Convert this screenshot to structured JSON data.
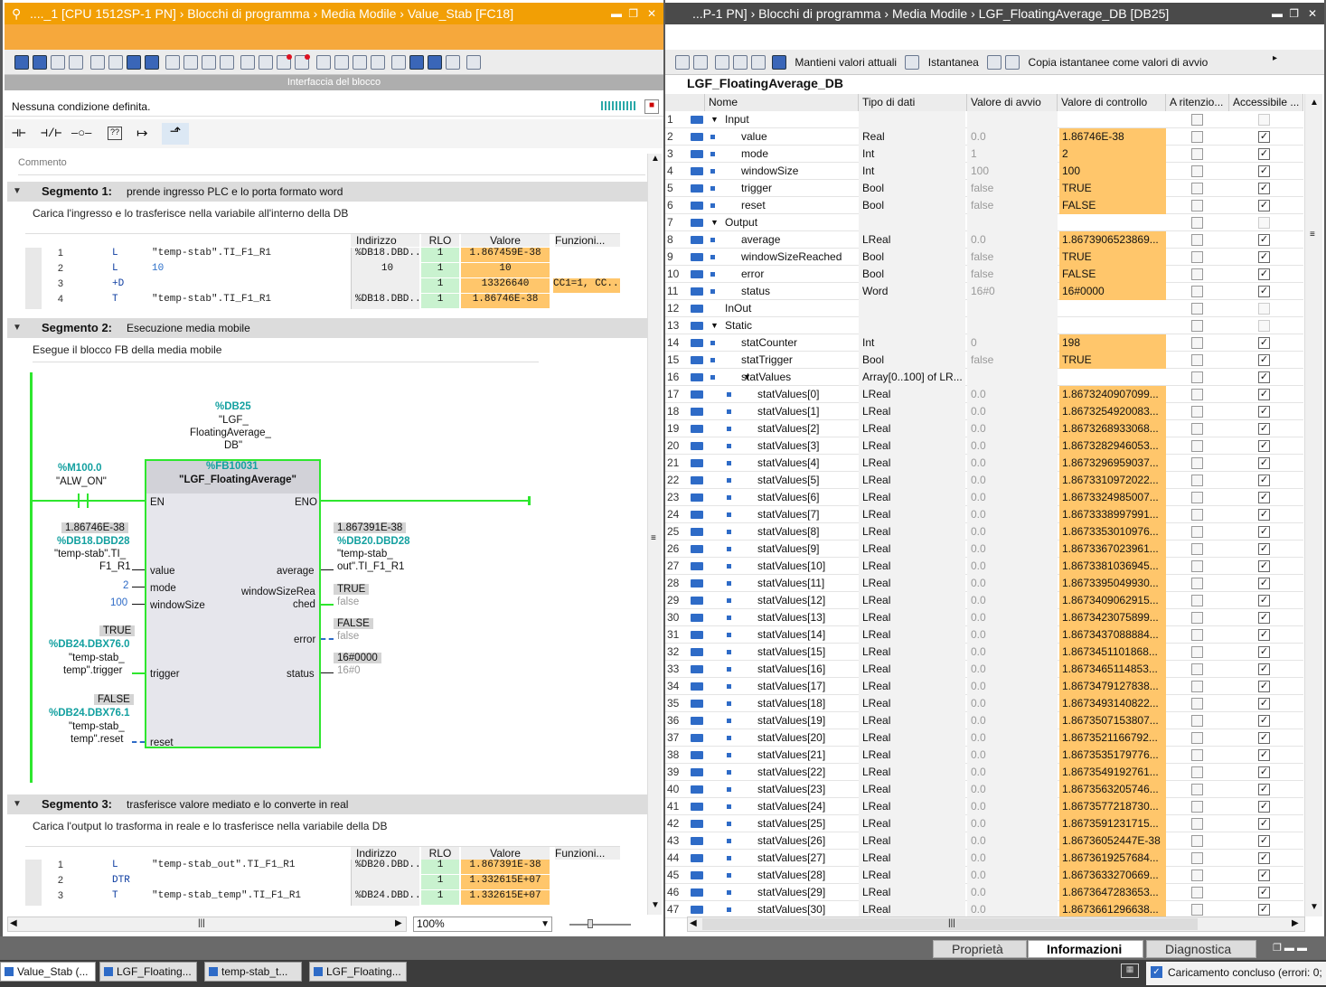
{
  "left": {
    "title": "...._1 [CPU 1512SP-1 PN]  ›  Blocchi di programma  ›  Media Modile  ›  Value_Stab [FC18]",
    "interface_label": "Interfaccia del blocco",
    "no_condition": "Nessuna condizione definita.",
    "comment_placeholder": "Commento",
    "zoom": "100%",
    "seg1": {
      "title": "Segmento 1:",
      "desc": "prende ingresso PLC e lo porta formato word",
      "comment": "Carica l'ingresso e lo trasferisce nella variabile all'interno della DB",
      "headers": {
        "addr": "Indirizzo",
        "rlo": "RLO",
        "val": "Valore",
        "fn": "Funzioni..."
      },
      "rows": [
        {
          "n": "1",
          "op": "L",
          "arg": "\"temp-stab\".TI_F1_R1",
          "addr": "%DB18.DBD...",
          "rlo": "1",
          "val": "1.867459E-38",
          "fn": ""
        },
        {
          "n": "2",
          "op": "L",
          "arg": "10",
          "addr": "10",
          "rlo": "1",
          "val": "10",
          "fn": ""
        },
        {
          "n": "3",
          "op": "+D",
          "arg": "",
          "addr": "",
          "rlo": "1",
          "val": "13326640",
          "fn": "CC1=1, CC..."
        },
        {
          "n": "4",
          "op": "T",
          "arg": "\"temp-stab\".TI_F1_R1",
          "addr": "%DB18.DBD...",
          "rlo": "1",
          "val": "1.86746E-38",
          "fn": ""
        }
      ]
    },
    "seg2": {
      "title": "Segmento 2:",
      "desc": "Esecuzione media mobile",
      "comment": "Esegue il blocco FB della media mobile",
      "db": "%DB25",
      "db_name1": "\"LGF_",
      "db_name2": "FloatingAverage_",
      "db_name3": "DB\"",
      "fb": "%FB10031",
      "fb_name": "\"LGF_FloatingAverage\"",
      "m_addr": "%M100.0",
      "m_name": "\"ALW_ON\"",
      "en": "EN",
      "eno": "ENO",
      "in_value_live": "1.86746E-38",
      "in_value_addr": "%DB18.DBD28",
      "in_value_name1": "\"temp-stab\".TI_",
      "in_value_name2": "F1_R1",
      "pin_value": "value",
      "pin_mode": "mode",
      "pin_window": "windowSize",
      "pin_trigger": "trigger",
      "pin_reset": "reset",
      "mode_val": "2",
      "window_val": "100",
      "trig_live": "TRUE",
      "trig_addr": "%DB24.DBX76.0",
      "trig_name1": "\"temp-stab_",
      "trig_name2": "temp\".trigger",
      "reset_live": "FALSE",
      "reset_addr": "%DB24.DBX76.1",
      "reset_name1": "\"temp-stab_",
      "reset_name2": "temp\".reset",
      "pin_average": "average",
      "pin_wsr1": "windowSizeRea",
      "pin_wsr2": "ched",
      "pin_error": "error",
      "pin_status": "status",
      "avg_live": "1.867391E-38",
      "avg_addr": "%DB20.DBD28",
      "avg_name1": "\"temp-stab_",
      "avg_name2": "out\".TI_F1_R1",
      "wsr_live": "TRUE",
      "wsr_def": "false",
      "err_live": "FALSE",
      "err_def": "false",
      "st_live": "16#0000",
      "st_def": "16#0"
    },
    "seg3": {
      "title": "Segmento 3:",
      "desc": "trasferisce valore mediato e lo converte in real",
      "comment": "Carica l'output lo trasforma in reale e lo trasferisce nella variabile della DB",
      "rows": [
        {
          "n": "1",
          "op": "L",
          "arg": "\"temp-stab_out\".TI_F1_R1",
          "addr": "%DB20.DBD...",
          "rlo": "1",
          "val": "1.867391E-38",
          "fn": ""
        },
        {
          "n": "2",
          "op": "DTR",
          "arg": "",
          "addr": "",
          "rlo": "1",
          "val": "1.332615E+07",
          "fn": ""
        },
        {
          "n": "3",
          "op": "T",
          "arg": "\"temp-stab_temp\".TI_F1_R1",
          "addr": "%DB24.DBD...",
          "rlo": "1",
          "val": "1.332615E+07",
          "fn": ""
        }
      ]
    }
  },
  "right": {
    "title": "...P-1 PN]  ›  Blocchi di programma  ›  Media Modile  ›  LGF_FloatingAverage_DB [DB25]",
    "toolbar": {
      "keep": "Mantieni valori attuali",
      "snapshot": "Istantanea",
      "copy": "Copia istantanee come valori di avvio"
    },
    "db_title": "LGF_FloatingAverage_DB",
    "headers": {
      "name": "Nome",
      "type": "Tipo di dati",
      "start": "Valore di avvio",
      "monitor": "Valore di controllo",
      "retain": "A ritenzio...",
      "access": "Accessibile ..."
    },
    "rows": [
      {
        "n": "1",
        "name": "Input",
        "lvl": 0,
        "tw": "▼",
        "type": "",
        "start": "",
        "mon": "",
        "dot": false,
        "acc": false
      },
      {
        "n": "2",
        "name": "value",
        "lvl": 1,
        "type": "Real",
        "start": "0.0",
        "mon": "1.86746E-38",
        "dot": true,
        "acc": true
      },
      {
        "n": "3",
        "name": "mode",
        "lvl": 1,
        "type": "Int",
        "start": "1",
        "mon": "2",
        "dot": true,
        "acc": true
      },
      {
        "n": "4",
        "name": "windowSize",
        "lvl": 1,
        "type": "Int",
        "start": "100",
        "mon": "100",
        "dot": true,
        "acc": true
      },
      {
        "n": "5",
        "name": "trigger",
        "lvl": 1,
        "type": "Bool",
        "start": "false",
        "mon": "TRUE",
        "dot": true,
        "acc": true
      },
      {
        "n": "6",
        "name": "reset",
        "lvl": 1,
        "type": "Bool",
        "start": "false",
        "mon": "FALSE",
        "dot": true,
        "acc": true
      },
      {
        "n": "7",
        "name": "Output",
        "lvl": 0,
        "tw": "▼",
        "type": "",
        "start": "",
        "mon": "",
        "dot": false,
        "acc": false
      },
      {
        "n": "8",
        "name": "average",
        "lvl": 1,
        "type": "LReal",
        "start": "0.0",
        "mon": "1.8673906523869...",
        "dot": true,
        "acc": true
      },
      {
        "n": "9",
        "name": "windowSizeReached",
        "lvl": 1,
        "type": "Bool",
        "start": "false",
        "mon": "TRUE",
        "dot": true,
        "acc": true
      },
      {
        "n": "10",
        "name": "error",
        "lvl": 1,
        "type": "Bool",
        "start": "false",
        "mon": "FALSE",
        "dot": true,
        "acc": true
      },
      {
        "n": "11",
        "name": "status",
        "lvl": 1,
        "type": "Word",
        "start": "16#0",
        "mon": "16#0000",
        "dot": true,
        "acc": true
      },
      {
        "n": "12",
        "name": "InOut",
        "lvl": 0,
        "tw": "",
        "type": "",
        "start": "",
        "mon": "",
        "dot": false,
        "acc": false
      },
      {
        "n": "13",
        "name": "Static",
        "lvl": 0,
        "tw": "▼",
        "type": "",
        "start": "",
        "mon": "",
        "dot": false,
        "acc": false
      },
      {
        "n": "14",
        "name": "statCounter",
        "lvl": 1,
        "type": "Int",
        "start": "0",
        "mon": "198",
        "dot": true,
        "acc": true
      },
      {
        "n": "15",
        "name": "statTrigger",
        "lvl": 1,
        "type": "Bool",
        "start": "false",
        "mon": "TRUE",
        "dot": true,
        "acc": true
      },
      {
        "n": "16",
        "name": "statValues",
        "lvl": 1,
        "tw": "▼",
        "type": "Array[0..100] of LR...",
        "start": "",
        "mon": "",
        "dot": true,
        "acc": true
      },
      {
        "n": "17",
        "name": "statValues[0]",
        "lvl": 2,
        "type": "LReal",
        "start": "0.0",
        "mon": "1.8673240907099...",
        "dot": true,
        "acc": true
      },
      {
        "n": "18",
        "name": "statValues[1]",
        "lvl": 2,
        "type": "LReal",
        "start": "0.0",
        "mon": "1.8673254920083...",
        "dot": true,
        "acc": true
      },
      {
        "n": "19",
        "name": "statValues[2]",
        "lvl": 2,
        "type": "LReal",
        "start": "0.0",
        "mon": "1.8673268933068...",
        "dot": true,
        "acc": true
      },
      {
        "n": "20",
        "name": "statValues[3]",
        "lvl": 2,
        "type": "LReal",
        "start": "0.0",
        "mon": "1.8673282946053...",
        "dot": true,
        "acc": true
      },
      {
        "n": "21",
        "name": "statValues[4]",
        "lvl": 2,
        "type": "LReal",
        "start": "0.0",
        "mon": "1.8673296959037...",
        "dot": true,
        "acc": true
      },
      {
        "n": "22",
        "name": "statValues[5]",
        "lvl": 2,
        "type": "LReal",
        "start": "0.0",
        "mon": "1.8673310972022...",
        "dot": true,
        "acc": true
      },
      {
        "n": "23",
        "name": "statValues[6]",
        "lvl": 2,
        "type": "LReal",
        "start": "0.0",
        "mon": "1.8673324985007...",
        "dot": true,
        "acc": true
      },
      {
        "n": "24",
        "name": "statValues[7]",
        "lvl": 2,
        "type": "LReal",
        "start": "0.0",
        "mon": "1.8673338997991...",
        "dot": true,
        "acc": true
      },
      {
        "n": "25",
        "name": "statValues[8]",
        "lvl": 2,
        "type": "LReal",
        "start": "0.0",
        "mon": "1.8673353010976...",
        "dot": true,
        "acc": true
      },
      {
        "n": "26",
        "name": "statValues[9]",
        "lvl": 2,
        "type": "LReal",
        "start": "0.0",
        "mon": "1.8673367023961...",
        "dot": true,
        "acc": true
      },
      {
        "n": "27",
        "name": "statValues[10]",
        "lvl": 2,
        "type": "LReal",
        "start": "0.0",
        "mon": "1.8673381036945...",
        "dot": true,
        "acc": true
      },
      {
        "n": "28",
        "name": "statValues[11]",
        "lvl": 2,
        "type": "LReal",
        "start": "0.0",
        "mon": "1.8673395049930...",
        "dot": true,
        "acc": true
      },
      {
        "n": "29",
        "name": "statValues[12]",
        "lvl": 2,
        "type": "LReal",
        "start": "0.0",
        "mon": "1.8673409062915...",
        "dot": true,
        "acc": true
      },
      {
        "n": "30",
        "name": "statValues[13]",
        "lvl": 2,
        "type": "LReal",
        "start": "0.0",
        "mon": "1.8673423075899...",
        "dot": true,
        "acc": true
      },
      {
        "n": "31",
        "name": "statValues[14]",
        "lvl": 2,
        "type": "LReal",
        "start": "0.0",
        "mon": "1.8673437088884...",
        "dot": true,
        "acc": true
      },
      {
        "n": "32",
        "name": "statValues[15]",
        "lvl": 2,
        "type": "LReal",
        "start": "0.0",
        "mon": "1.8673451101868...",
        "dot": true,
        "acc": true
      },
      {
        "n": "33",
        "name": "statValues[16]",
        "lvl": 2,
        "type": "LReal",
        "start": "0.0",
        "mon": "1.8673465114853...",
        "dot": true,
        "acc": true
      },
      {
        "n": "34",
        "name": "statValues[17]",
        "lvl": 2,
        "type": "LReal",
        "start": "0.0",
        "mon": "1.8673479127838...",
        "dot": true,
        "acc": true
      },
      {
        "n": "35",
        "name": "statValues[18]",
        "lvl": 2,
        "type": "LReal",
        "start": "0.0",
        "mon": "1.8673493140822...",
        "dot": true,
        "acc": true
      },
      {
        "n": "36",
        "name": "statValues[19]",
        "lvl": 2,
        "type": "LReal",
        "start": "0.0",
        "mon": "1.8673507153807...",
        "dot": true,
        "acc": true
      },
      {
        "n": "37",
        "name": "statValues[20]",
        "lvl": 2,
        "type": "LReal",
        "start": "0.0",
        "mon": "1.8673521166792...",
        "dot": true,
        "acc": true
      },
      {
        "n": "38",
        "name": "statValues[21]",
        "lvl": 2,
        "type": "LReal",
        "start": "0.0",
        "mon": "1.8673535179776...",
        "dot": true,
        "acc": true
      },
      {
        "n": "39",
        "name": "statValues[22]",
        "lvl": 2,
        "type": "LReal",
        "start": "0.0",
        "mon": "1.8673549192761...",
        "dot": true,
        "acc": true
      },
      {
        "n": "40",
        "name": "statValues[23]",
        "lvl": 2,
        "type": "LReal",
        "start": "0.0",
        "mon": "1.8673563205746...",
        "dot": true,
        "acc": true
      },
      {
        "n": "41",
        "name": "statValues[24]",
        "lvl": 2,
        "type": "LReal",
        "start": "0.0",
        "mon": "1.8673577218730...",
        "dot": true,
        "acc": true
      },
      {
        "n": "42",
        "name": "statValues[25]",
        "lvl": 2,
        "type": "LReal",
        "start": "0.0",
        "mon": "1.8673591231715...",
        "dot": true,
        "acc": true
      },
      {
        "n": "43",
        "name": "statValues[26]",
        "lvl": 2,
        "type": "LReal",
        "start": "0.0",
        "mon": "1.86736052447E-38",
        "dot": true,
        "acc": true
      },
      {
        "n": "44",
        "name": "statValues[27]",
        "lvl": 2,
        "type": "LReal",
        "start": "0.0",
        "mon": "1.8673619257684...",
        "dot": true,
        "acc": true
      },
      {
        "n": "45",
        "name": "statValues[28]",
        "lvl": 2,
        "type": "LReal",
        "start": "0.0",
        "mon": "1.8673633270669...",
        "dot": true,
        "acc": true
      },
      {
        "n": "46",
        "name": "statValues[29]",
        "lvl": 2,
        "type": "LReal",
        "start": "0.0",
        "mon": "1.8673647283653...",
        "dot": true,
        "acc": true
      },
      {
        "n": "47",
        "name": "statValues[30]",
        "lvl": 2,
        "type": "LReal",
        "start": "0.0",
        "mon": "1.8673661296638...",
        "dot": true,
        "acc": true
      }
    ]
  },
  "bottom": {
    "tabs": [
      "Proprietà",
      "Informazioni",
      "Diagnostica"
    ],
    "taskbar": [
      "Value_Stab (...",
      "LGF_Floating...",
      "temp-stab_t...",
      "LGF_Floating..."
    ],
    "status": "Caricamento concluso (errori: 0;"
  },
  "colors": {
    "accent": "#f29f05",
    "monitor": "#ffc66b",
    "rlo": "#c9f2cf",
    "active": "#2ee62e",
    "teal": "#13a0a0",
    "dbicon": "#2e6bc7"
  }
}
